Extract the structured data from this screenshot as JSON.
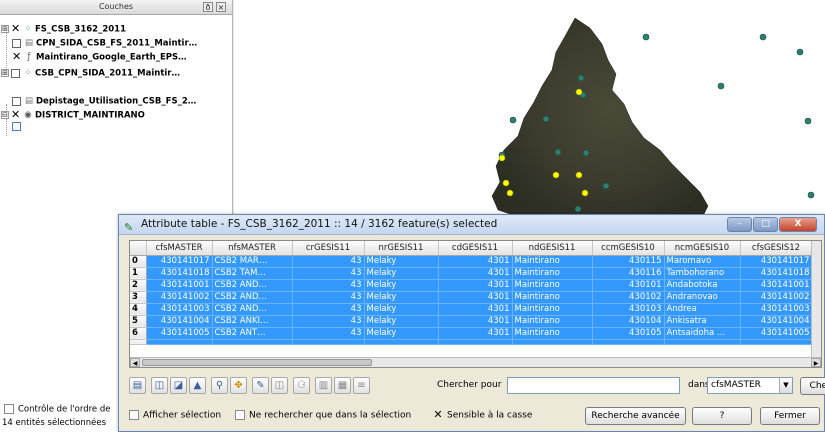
{
  "layers_panel": {
    "title": "Couches",
    "float_btn": "ð",
    "close_btn": "×",
    "layers": [
      {
        "name": "FS_CSB_3162_2011",
        "expander": "⊞",
        "checked": "✕",
        "icon": "⁘"
      },
      {
        "name": "CPN_SIDA_CSB_FS_2011_Maintir…",
        "expander": "",
        "checked": "",
        "icon": "▤"
      },
      {
        "name": "Maintirano_Google_Earth_EPS…",
        "expander": "",
        "checked": "✕",
        "icon": "ƒ"
      },
      {
        "name": "CSB_CPN_SIDA_2011_Maintir…",
        "expander": "⊞",
        "checked": "",
        "icon": "⁘"
      },
      {
        "name": "Depistage_Utilisation_CSB_FS_2…",
        "expander": "",
        "checked": "",
        "icon": "▤"
      },
      {
        "name": "DISTRICT_MAINTIRANO",
        "expander": "⊟",
        "checked": "✕",
        "icon": "◉"
      }
    ],
    "order_control": "Contrôle de l'ordre de",
    "status": "14 entités sélectionnées"
  },
  "map": {
    "region_color": "#3c3d2e",
    "point_color": "#2f7f6e",
    "selected_color": "#ffff00"
  },
  "attribute_table": {
    "title": "Attribute table - FS_CSB_3162_2011 :: 14 / 3162 feature(s) selected",
    "columns": [
      "cfsMASTER",
      "nfsMASTER",
      "crGESIS11",
      "nrGESIS11",
      "cdGESIS11",
      "ndGESIS11",
      "ccmGESIS10",
      "ncmGESIS10",
      "cfsGESIS12"
    ],
    "rows": [
      {
        "row": "0",
        "cells": [
          "430141017",
          "CSB2 MAR…",
          "43",
          "Melaky",
          "4301",
          "Maintirano",
          "430115",
          "Maromavo",
          "430141017"
        ]
      },
      {
        "row": "1",
        "cells": [
          "430141018",
          "CSB2 TAM…",
          "43",
          "Melaky",
          "4301",
          "Maintirano",
          "430116",
          "Tambohorano",
          "430141018"
        ]
      },
      {
        "row": "2",
        "cells": [
          "430141001",
          "CSB2 AND…",
          "43",
          "Melaky",
          "4301",
          "Maintirano",
          "430101",
          "Andabotoka",
          "430141001"
        ]
      },
      {
        "row": "3",
        "cells": [
          "430141002",
          "CSB2 AND…",
          "43",
          "Melaky",
          "4301",
          "Maintirano",
          "430102",
          "Andranovao",
          "430141002"
        ]
      },
      {
        "row": "4",
        "cells": [
          "430141003",
          "CSB2 AND…",
          "43",
          "Melaky",
          "4301",
          "Maintirano",
          "430103",
          "Andrea",
          "430141003"
        ]
      },
      {
        "row": "5",
        "cells": [
          "430141004",
          "CSB2 ANKI…",
          "43",
          "Melaky",
          "4301",
          "Maintirano",
          "430104",
          "Ankisatra",
          "430141004"
        ]
      },
      {
        "row": "6",
        "cells": [
          "430141005",
          "CSB2 ANT…",
          "43",
          "Melaky",
          "4301",
          "Maintirano",
          "430105",
          "Antsaidoha …",
          "430141005"
        ]
      }
    ],
    "search": {
      "label": "Chercher pour",
      "value": "",
      "in_label": "dans",
      "field": "cfsMASTER",
      "button": "Chercher"
    },
    "options": {
      "show_selection": "Afficher sélection",
      "search_in_selection": "Ne rechercher que dans la sélection",
      "case_sensitive": "Sensible à la casse",
      "case_sensitive_mark": "✕",
      "advanced": "Recherche avancée",
      "help": "?",
      "close": "Fermer"
    },
    "window_buttons": {
      "minimize": "–",
      "maximize": "□",
      "close": "X"
    },
    "toolbar_icons": [
      "select-all-icon",
      "invert-selection-icon",
      "remove-selection-icon",
      "move-selection-top-icon",
      "zoom-to-selection-icon",
      "pan-to-selection-icon",
      "edit-icon",
      "save-icon",
      "delete-icon",
      "new-column-icon",
      "field-calculator-icon",
      "open-form-icon"
    ]
  }
}
